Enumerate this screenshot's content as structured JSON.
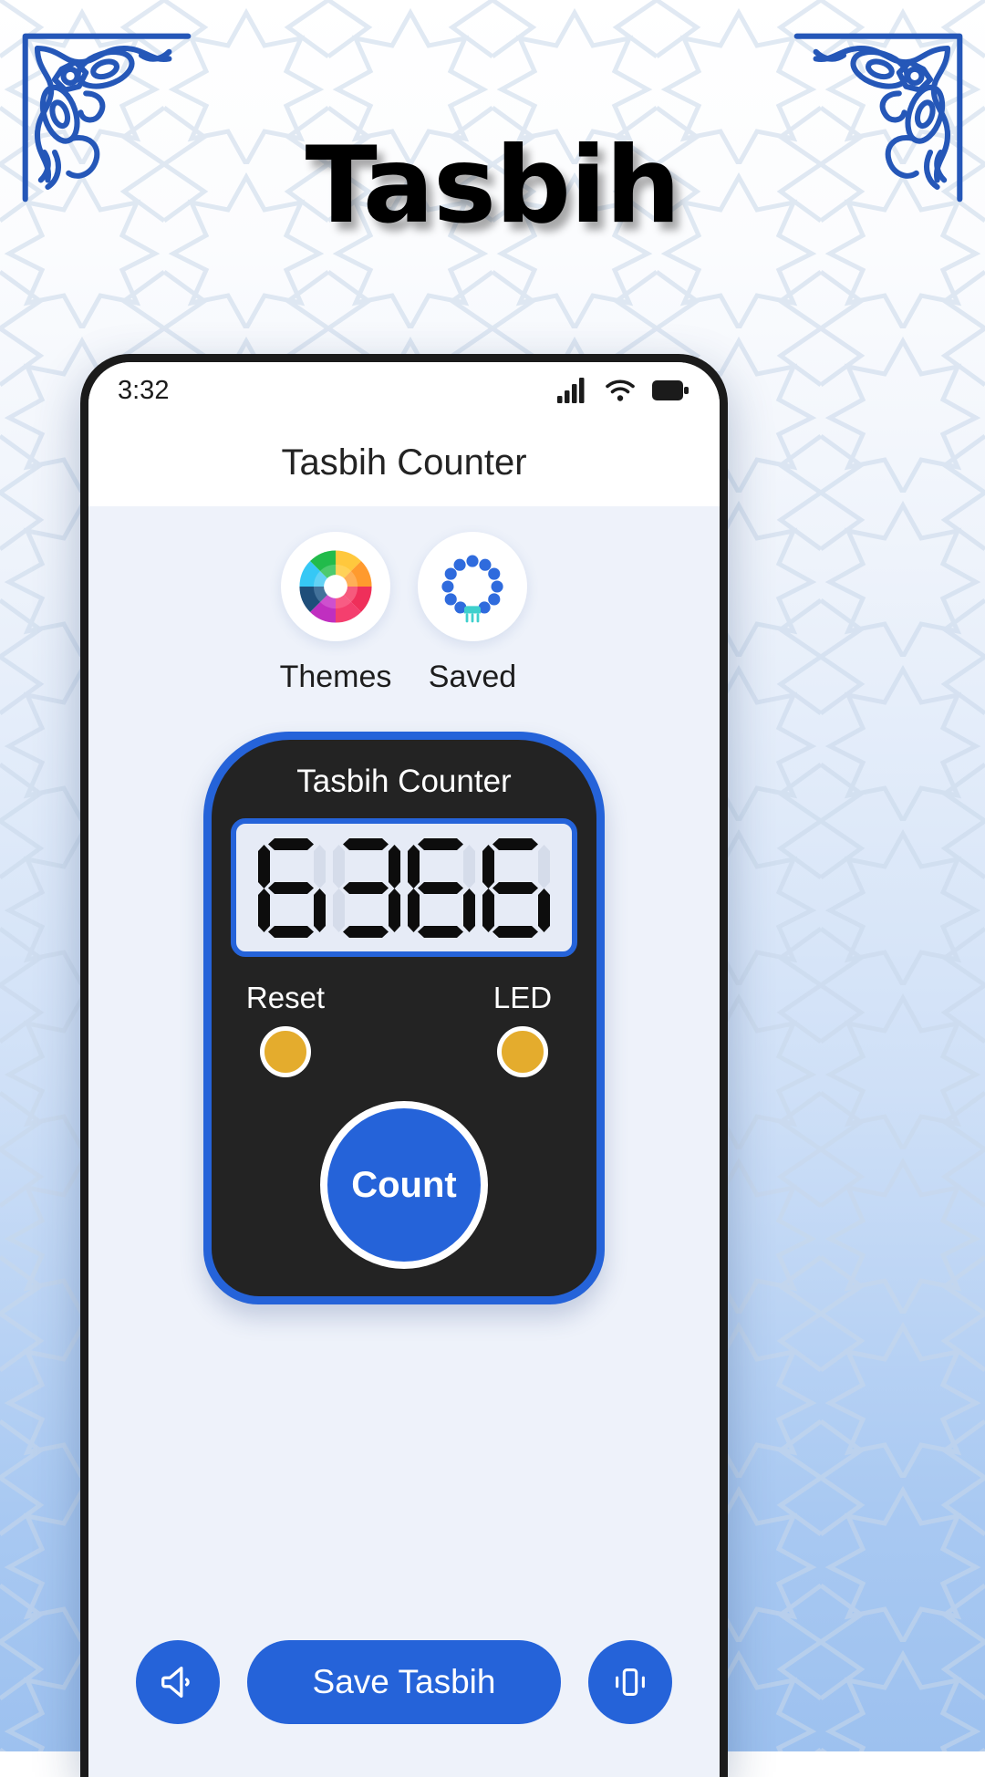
{
  "promo": {
    "title": "Tasbih",
    "ornament_left": "islamic-corner-ornament-icon",
    "ornament_right": "islamic-corner-ornament-icon",
    "accent_color": "#2557b8",
    "background_colors": [
      "#ffffff",
      "#cfe0f7",
      "#9dc1ef"
    ]
  },
  "phone": {
    "status_bar": {
      "time": "3:32",
      "icons": [
        "signal-icon",
        "wifi-icon",
        "battery-icon"
      ]
    },
    "app_bar": {
      "title": "Tasbih Counter"
    },
    "quick_actions": [
      {
        "icon": "color-wheel-icon",
        "label": "Themes"
      },
      {
        "icon": "prayer-beads-icon",
        "label": "Saved"
      }
    ],
    "counter": {
      "title": "Tasbih Counter",
      "display_value": "6366",
      "digits": [
        "6",
        "3",
        "6",
        "6"
      ],
      "reset_label": "Reset",
      "led_label": "LED",
      "count_label": "Count",
      "knob_color": "#e4ac2d",
      "shell_color": "#2563d9",
      "body_color": "#232323",
      "lcd_color": "#e6ebf6"
    },
    "bottom_bar": {
      "sound_icon": "speaker-icon",
      "save_label": "Save Tasbih",
      "vibrate_icon": "vibrate-icon"
    }
  }
}
